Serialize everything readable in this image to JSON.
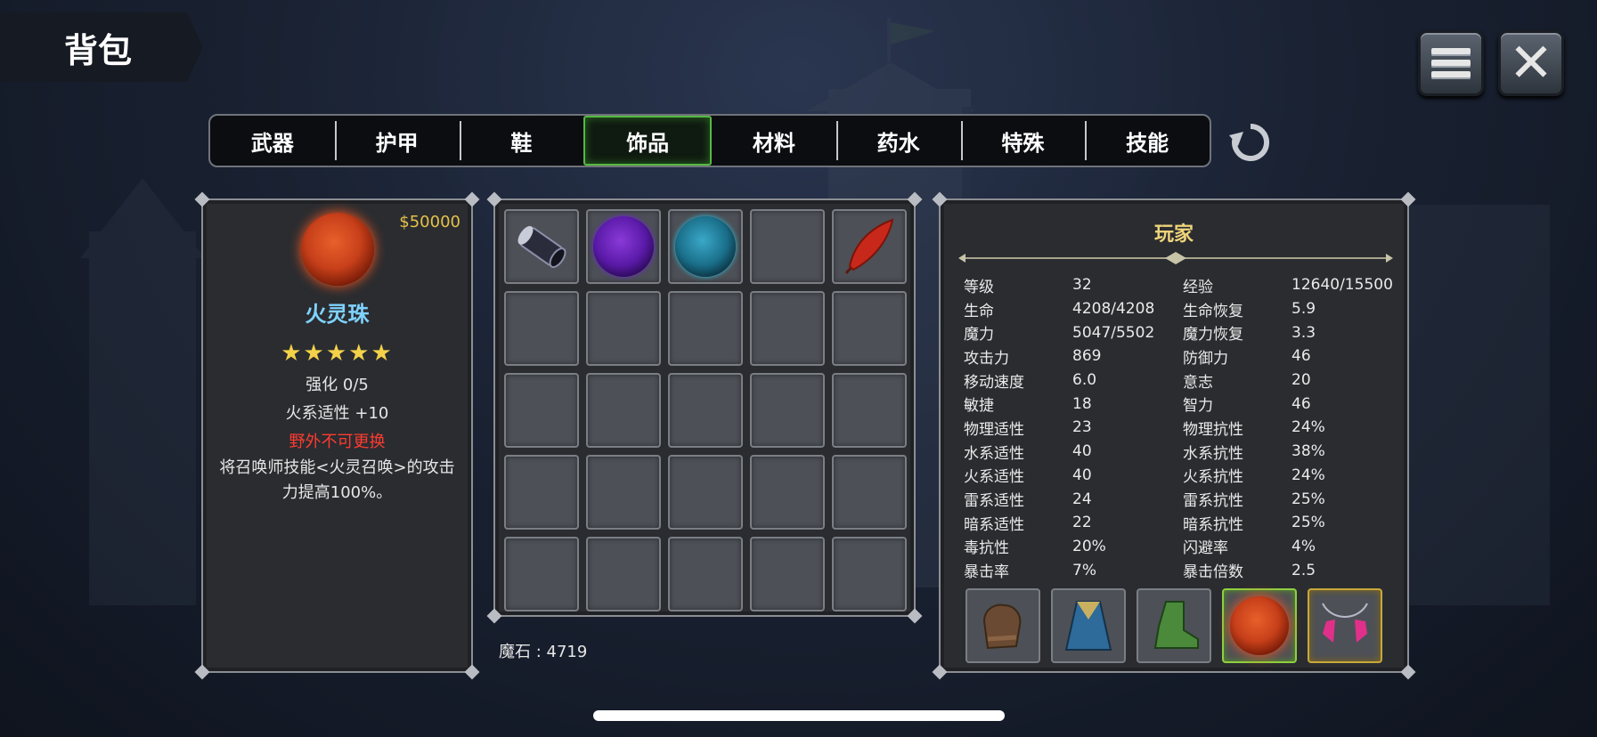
{
  "header": {
    "title": "背包"
  },
  "tabs": [
    {
      "label": "武器",
      "active": false
    },
    {
      "label": "护甲",
      "active": false
    },
    {
      "label": "鞋",
      "active": false
    },
    {
      "label": "饰品",
      "active": true
    },
    {
      "label": "材料",
      "active": false
    },
    {
      "label": "药水",
      "active": false
    },
    {
      "label": "特殊",
      "active": false
    },
    {
      "label": "技能",
      "active": false
    }
  ],
  "icons": {
    "menu": "menu-icon",
    "close": "close-icon",
    "refresh": "refresh-icon"
  },
  "detail": {
    "price": "$50000",
    "name": "火灵珠",
    "stars": "★★★★★",
    "enhance": "强化 0/5",
    "fire_affinity": "火系适性  +10",
    "restriction": "野外不可更换",
    "description": "将召唤师技能<火灵召唤>的攻击力提高100%。"
  },
  "inventory": {
    "slots": [
      "scroll-tube-icon",
      "purple-orb-icon",
      "cyan-orb-icon",
      "",
      "red-feather-icon"
    ],
    "magic_stone": "魔石 : 4719"
  },
  "player": {
    "title": "玩家",
    "stats": [
      [
        "等级",
        "32",
        "经验",
        "12640/15500"
      ],
      [
        "生命",
        "4208/4208",
        "生命恢复",
        "5.9"
      ],
      [
        "魔力",
        "5047/5502",
        "魔力恢复",
        "3.3"
      ],
      [
        "攻击力",
        "869",
        "防御力",
        "46"
      ],
      [
        "移动速度",
        "6.0",
        "意志",
        "20"
      ],
      [
        "敏捷",
        "18",
        "智力",
        "46"
      ],
      [
        "物理适性",
        "23",
        "物理抗性",
        "24%"
      ],
      [
        "水系适性",
        "40",
        "水系抗性",
        "38%"
      ],
      [
        "火系适性",
        "40",
        "火系抗性",
        "24%"
      ],
      [
        "雷系适性",
        "24",
        "雷系抗性",
        "25%"
      ],
      [
        "暗系适性",
        "22",
        "暗系抗性",
        "25%"
      ],
      [
        "毒抗性",
        "20%",
        "闪避率",
        "4%"
      ],
      [
        "暴击率",
        "7%",
        "暴击倍数",
        "2.5"
      ]
    ],
    "equipment": [
      "glove-icon",
      "robe-icon",
      "boot-icon",
      "fire-orb-icon",
      "necklace-icon"
    ]
  },
  "colors": {
    "active_tab_border": "#56b844",
    "price": "#e6c24a",
    "item_name": "#7fd3ff",
    "warning": "#ff3b30",
    "player_title": "#f0d47a"
  }
}
